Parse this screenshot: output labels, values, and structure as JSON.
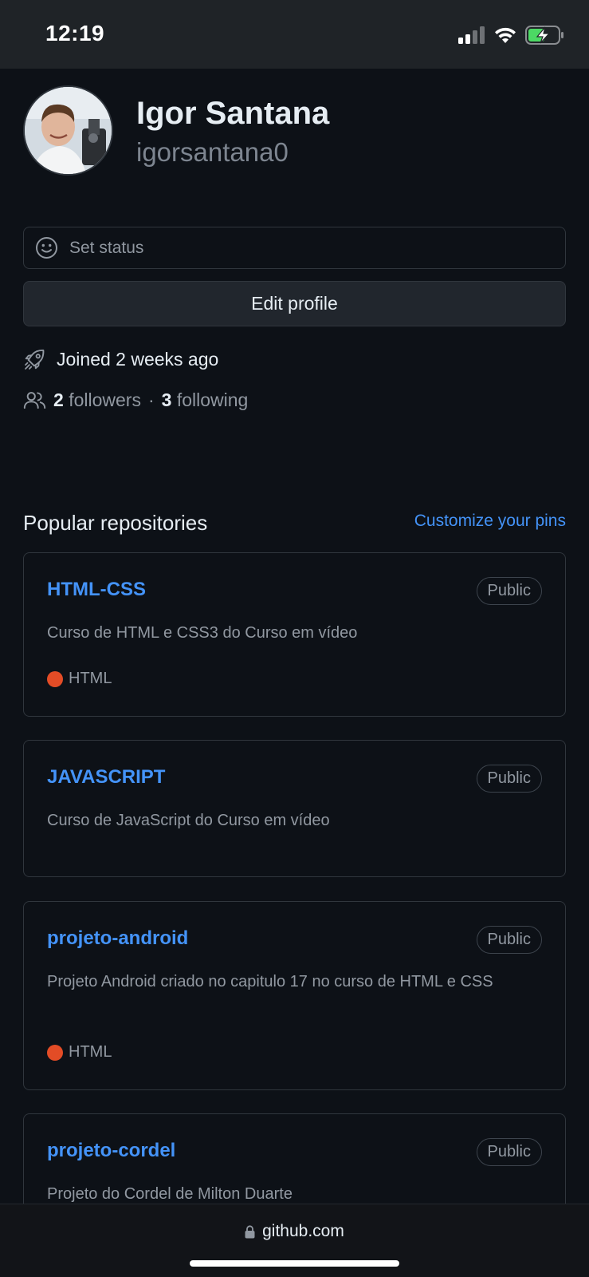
{
  "status_bar": {
    "time": "12:19"
  },
  "profile": {
    "name": "Igor Santana",
    "username": "igorsantana0",
    "set_status_label": "Set status",
    "edit_profile_label": "Edit profile",
    "joined_text": "Joined 2 weeks ago",
    "followers_count": "2",
    "followers_label": "followers",
    "separator": "·",
    "following_count": "3",
    "following_label": "following"
  },
  "repos_section": {
    "title": "Popular repositories",
    "customize_label": "Customize your pins",
    "repos": [
      {
        "name": "HTML-CSS",
        "visibility": "Public",
        "description": "Curso de HTML e CSS3 do Curso em vídeo",
        "language": "HTML",
        "language_color": "#e34c26"
      },
      {
        "name": "JAVASCRIPT",
        "visibility": "Public",
        "description": "Curso de JavaScript do Curso em vídeo",
        "language": "",
        "language_color": ""
      },
      {
        "name": "projeto-android",
        "visibility": "Public",
        "description": "Projeto Android criado no capitulo 17 no curso de HTML e CSS",
        "language": "HTML",
        "language_color": "#e34c26"
      },
      {
        "name": "projeto-cordel",
        "visibility": "Public",
        "description": "Projeto do Cordel de Milton Duarte",
        "language": "",
        "language_color": ""
      }
    ]
  },
  "browser": {
    "url": "github.com"
  },
  "colors": {
    "background": "#0d1117",
    "link": "#4493f8",
    "muted_text": "#9198a1",
    "border": "#30363d"
  }
}
